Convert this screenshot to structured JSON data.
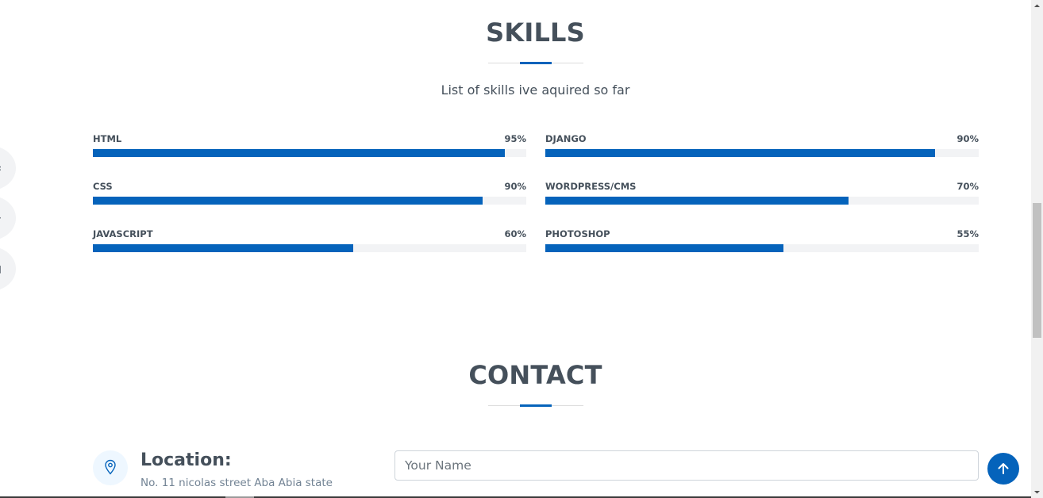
{
  "side_buttons": [
    {
      "glyph": "‹"
    },
    {
      "glyph": "·"
    },
    {
      "glyph": "▯"
    }
  ],
  "skills_section": {
    "title": "SKILLS",
    "subtitle": "List of skills ive aquired so far",
    "accent_color": "#0563bb",
    "left_column": [
      {
        "name": "HTML",
        "value_label": "95%",
        "percent": 95
      },
      {
        "name": "CSS",
        "value_label": "90%",
        "percent": 90
      },
      {
        "name": "JAVASCRIPT",
        "value_label": "60%",
        "percent": 60
      }
    ],
    "right_column": [
      {
        "name": "DJANGO",
        "value_label": "90%",
        "percent": 90
      },
      {
        "name": "WORDPRESS/CMS",
        "value_label": "70%",
        "percent": 70
      },
      {
        "name": "PHOTOSHOP",
        "value_label": "55%",
        "percent": 55
      }
    ]
  },
  "contact_section": {
    "title": "CONTACT",
    "location": {
      "icon": "map-pin-icon",
      "title": "Location:",
      "address": "No. 11 nicolas street Aba Abia state"
    },
    "form": {
      "name_placeholder": "Your Name",
      "name_value": ""
    }
  },
  "back_to_top": {
    "icon": "arrow-up-icon",
    "color": "#0563bb"
  }
}
